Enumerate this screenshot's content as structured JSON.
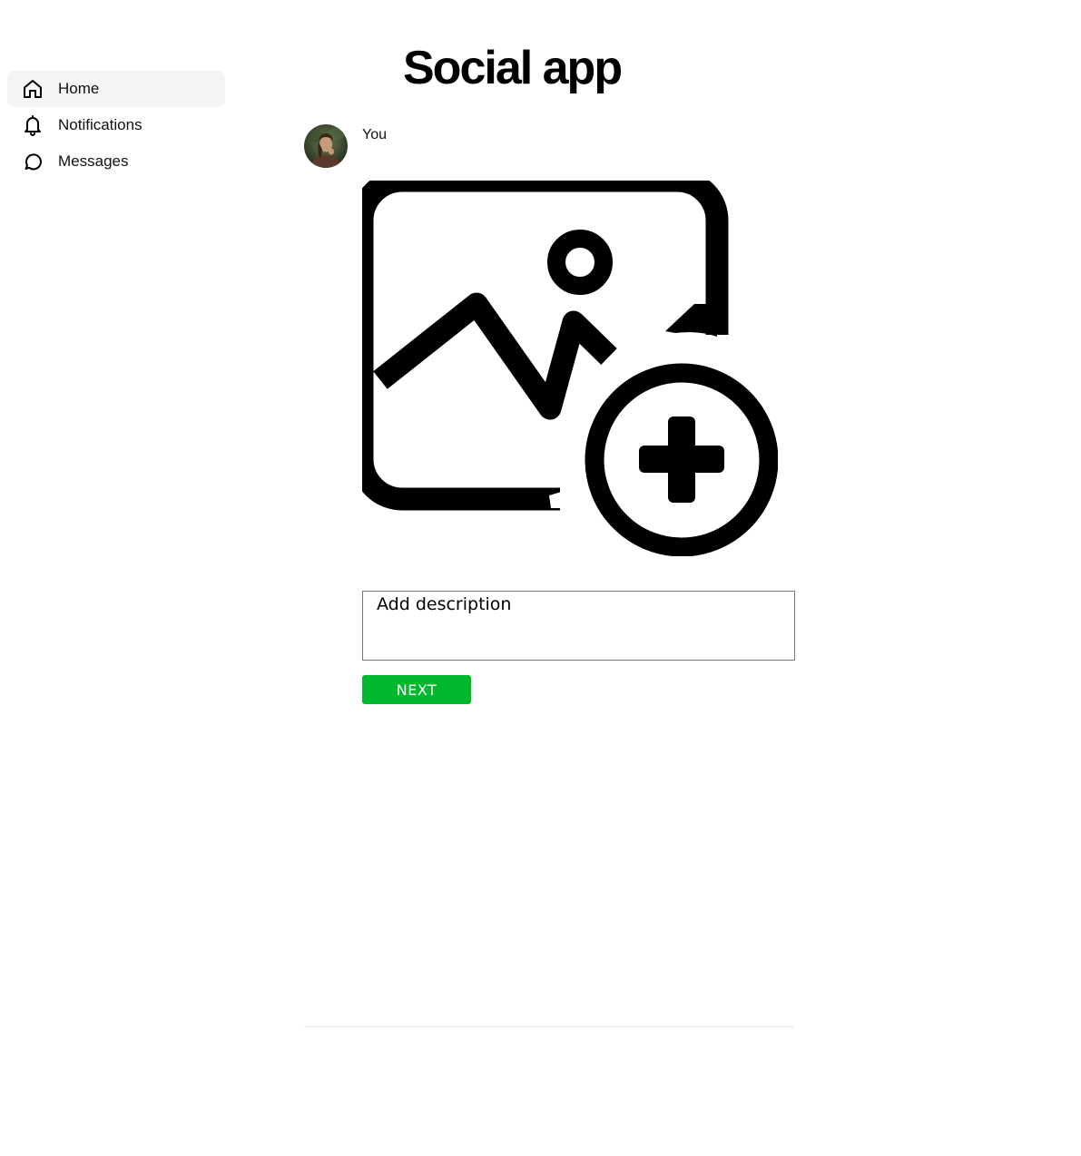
{
  "app": {
    "title": "Social app"
  },
  "sidebar": {
    "items": [
      {
        "label": "Home",
        "icon": "home-icon",
        "active": true
      },
      {
        "label": "Notifications",
        "icon": "bell-icon",
        "active": false
      },
      {
        "label": "Messages",
        "icon": "message-icon",
        "active": false
      }
    ]
  },
  "post": {
    "author": "You",
    "image_icon": "add-image-icon",
    "description_placeholder": "Add description",
    "description_value": "",
    "next_label": "NEXT"
  },
  "colors": {
    "accent": "#00b82e",
    "active_nav_bg": "#f5f5f5",
    "divider": "#e5e5e5"
  }
}
